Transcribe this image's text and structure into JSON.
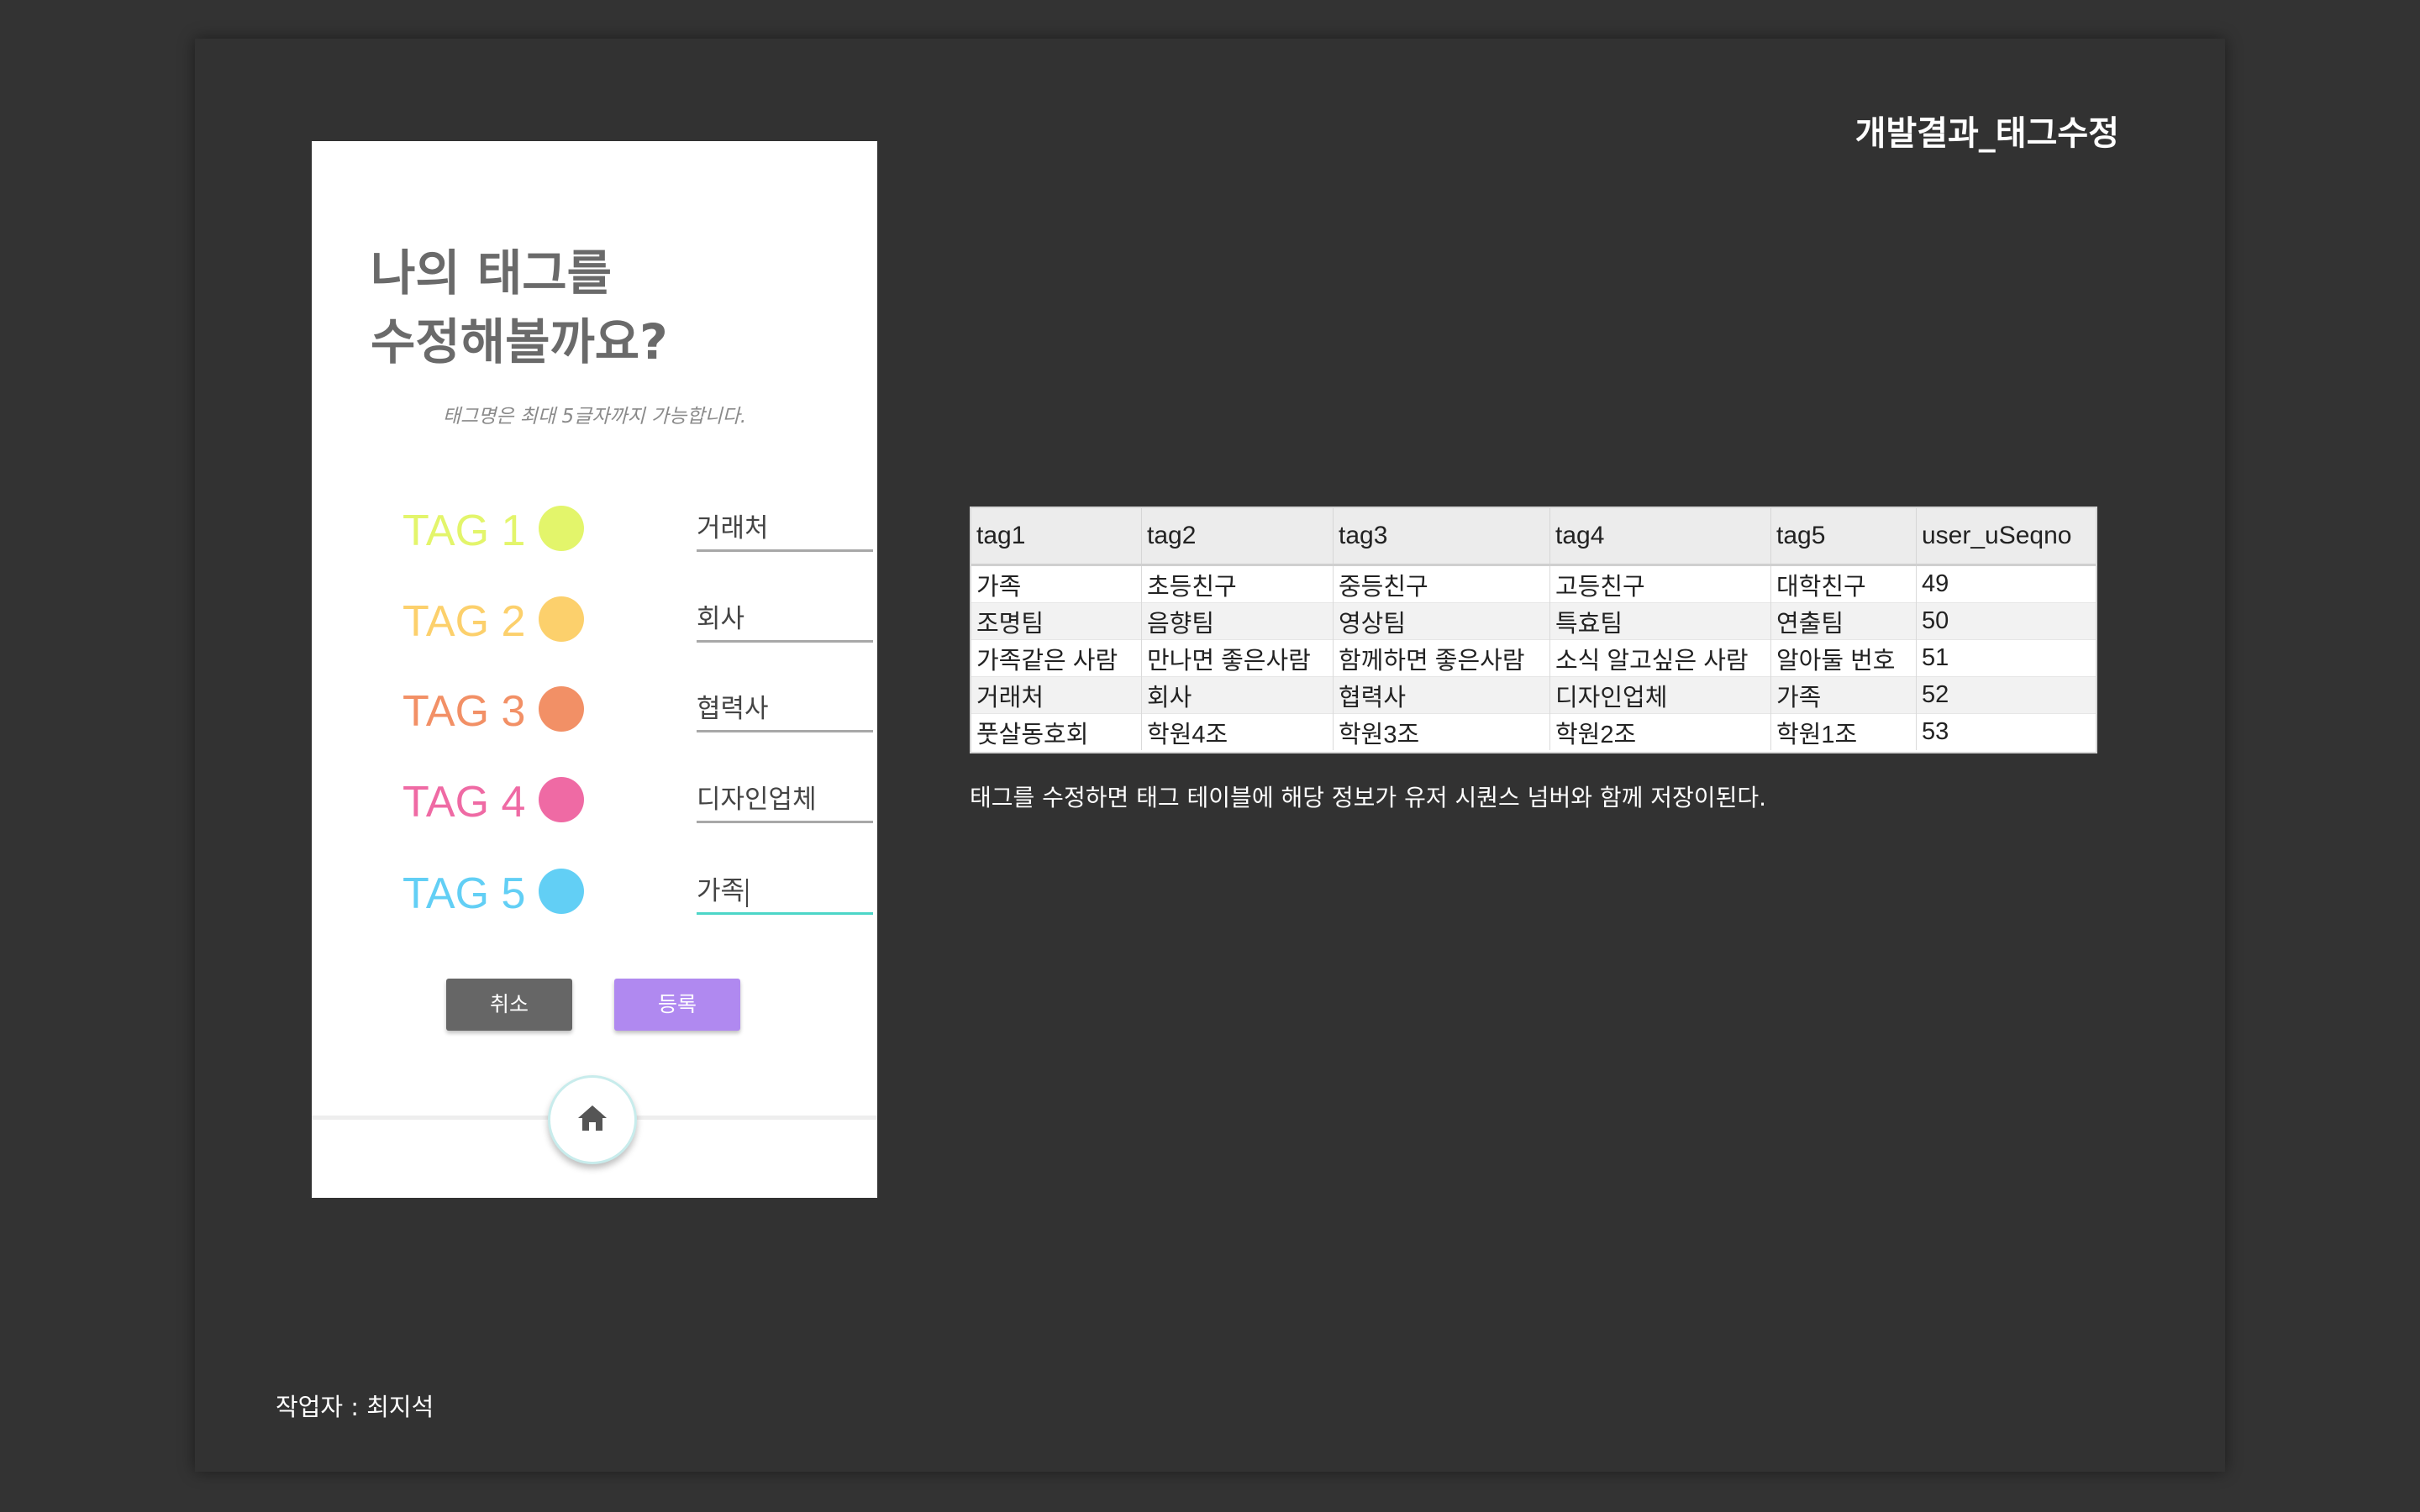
{
  "slide": {
    "title": "개발결과_태그수정",
    "author": "작업자 : 최지석"
  },
  "phone": {
    "heading_line1": "나의 태그를",
    "heading_line2": "수정해볼까요?",
    "hint": "태그명은 최대 5글자까지 가능합니다.",
    "tags": [
      {
        "label": "TAG 1",
        "value": "거래처",
        "color": "#e3f56b"
      },
      {
        "label": "TAG 2",
        "value": "회사",
        "color": "#fcd06c"
      },
      {
        "label": "TAG 3",
        "value": "협력사",
        "color": "#f29066"
      },
      {
        "label": "TAG 4",
        "value": "디자인업체",
        "color": "#ef6aa4"
      },
      {
        "label": "TAG 5",
        "value": "가족",
        "color": "#62cff5"
      }
    ],
    "cancel_label": "취소",
    "submit_label": "등록",
    "home_icon": "home-icon"
  },
  "table": {
    "columns": [
      "tag1",
      "tag2",
      "tag3",
      "tag4",
      "tag5",
      "user_uSeqno"
    ],
    "rows": [
      [
        "가족",
        "초등친구",
        "중등친구",
        "고등친구",
        "대학친구",
        "49"
      ],
      [
        "조명팀",
        "음향팀",
        "영상팀",
        "특효팀",
        "연출팀",
        "50"
      ],
      [
        "가족같은 사람",
        "만나면 좋은사람",
        "함께하면 좋은사람",
        "소식 알고싶은 사람",
        "알아둘 번호",
        "51"
      ],
      [
        "거래처",
        "회사",
        "협력사",
        "디자인업체",
        "가족",
        "52"
      ],
      [
        "풋살동호회",
        "학원4조",
        "학원3조",
        "학원2조",
        "학원1조",
        "53"
      ]
    ]
  },
  "caption": "태그를 수정하면 태그 테이블에 해당 정보가 유저 시퀀스 넘버와 함께 저장이된다."
}
